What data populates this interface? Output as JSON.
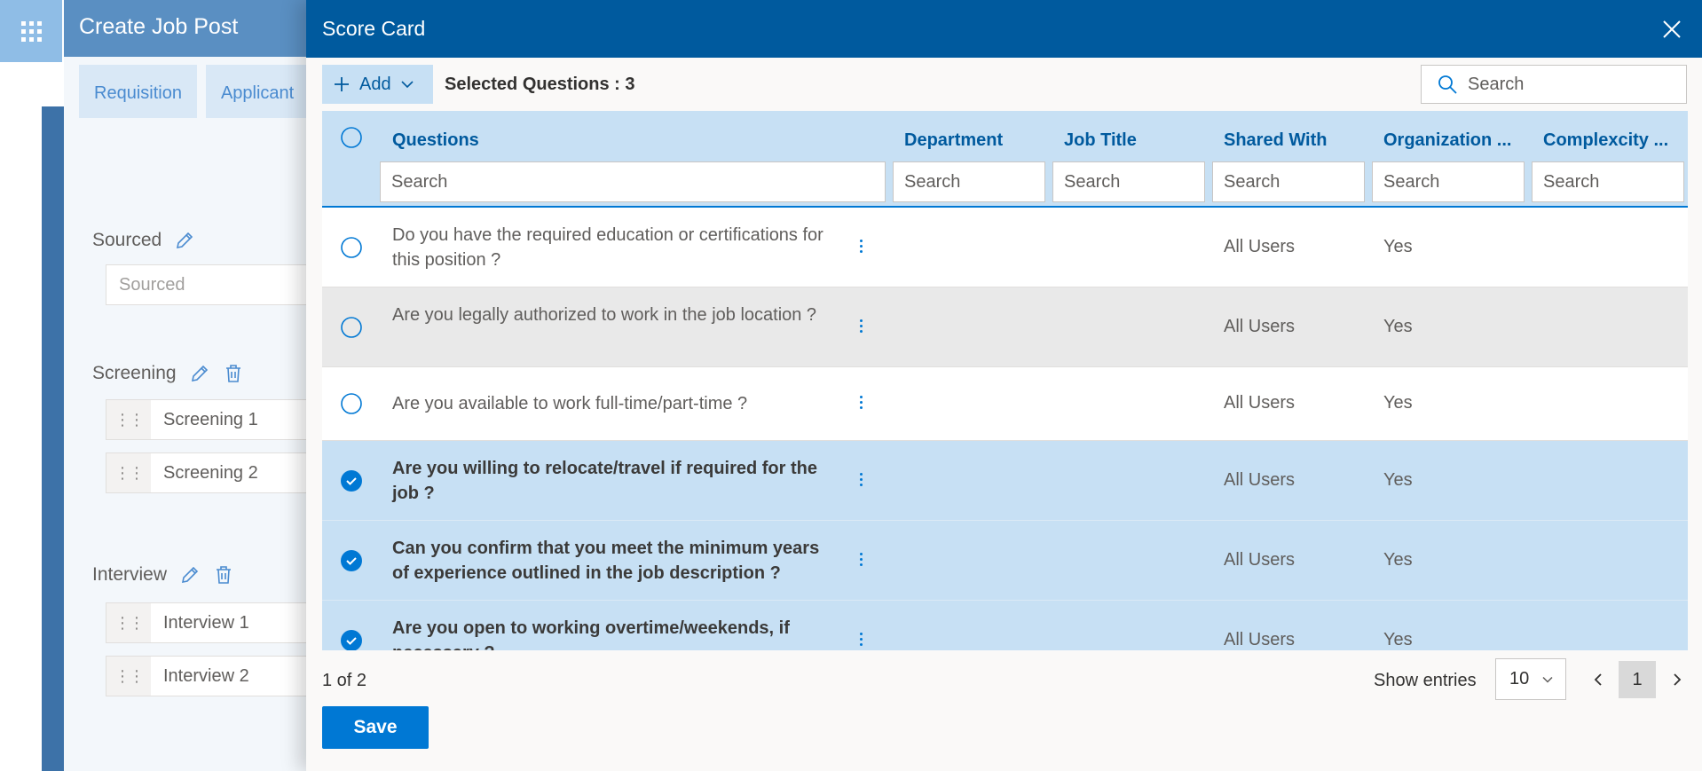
{
  "background": {
    "title": "Create Job Post",
    "tabs": [
      "Requisition",
      "Applicant"
    ],
    "sourced": {
      "label": "Sourced",
      "placeholder": "Sourced"
    },
    "screening": {
      "label": "Screening",
      "stages": [
        "Screening 1",
        "Screening 2"
      ]
    },
    "interview": {
      "label": "Interview",
      "stages": [
        "Interview 1",
        "Interview 2"
      ]
    }
  },
  "modal": {
    "title": "Score Card",
    "close_icon": "close-icon"
  },
  "toolbar": {
    "add_label": "Add",
    "selected_label": "Selected Questions : 3",
    "search_placeholder": "Search"
  },
  "grid": {
    "columns": [
      {
        "label": "Questions",
        "search": "Search"
      },
      {
        "label": "Department",
        "search": "Search"
      },
      {
        "label": "Job Title",
        "search": "Search"
      },
      {
        "label": "Shared With",
        "search": "Search"
      },
      {
        "label": "Organization ...",
        "search": "Search"
      },
      {
        "label": "Complexcity ...",
        "search": "Search"
      }
    ],
    "rows": [
      {
        "question": "Do you have the required education or certifications for this position ?",
        "department": "",
        "job_title": "",
        "shared_with": "All Users",
        "organization": "Yes",
        "complexity": "",
        "selected": false
      },
      {
        "question": "Are you legally authorized to work in the job location ?",
        "department": "",
        "job_title": "",
        "shared_with": "All Users",
        "organization": "Yes",
        "complexity": "",
        "selected": false
      },
      {
        "question": "Are you available to work full-time/part-time ?",
        "department": "",
        "job_title": "",
        "shared_with": "All Users",
        "organization": "Yes",
        "complexity": "",
        "selected": false
      },
      {
        "question": "Are you willing to relocate/travel if required for the job ?",
        "department": "",
        "job_title": "",
        "shared_with": "All Users",
        "organization": "Yes",
        "complexity": "",
        "selected": true
      },
      {
        "question": "Can you confirm that you meet the minimum years of experience outlined in the job description ?",
        "department": "",
        "job_title": "",
        "shared_with": "All Users",
        "organization": "Yes",
        "complexity": "",
        "selected": true
      },
      {
        "question": "Are you open to working overtime/weekends, if necessary ?",
        "department": "",
        "job_title": "",
        "shared_with": "All Users",
        "organization": "Yes",
        "complexity": "",
        "selected": true
      }
    ]
  },
  "footer": {
    "page_info": "1 of 2",
    "show_entries_label": "Show entries",
    "entries_value": "10",
    "current_page": "1",
    "save_label": "Save"
  },
  "colors": {
    "header_blue": "#005a9e",
    "accent": "#0078d4",
    "selected_row": "#c7e0f4",
    "hover_row": "#e9e9e9"
  }
}
